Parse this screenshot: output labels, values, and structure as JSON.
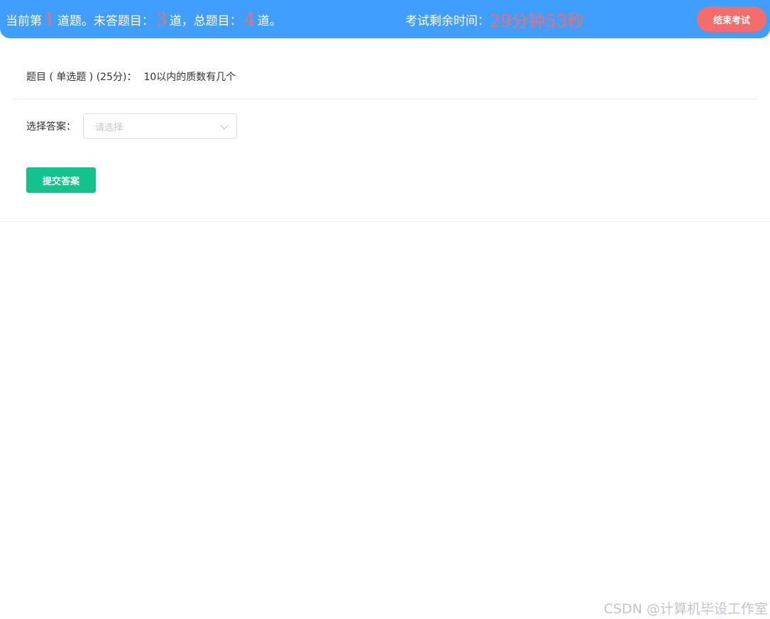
{
  "header": {
    "progress_prefix": "当前第",
    "current_index": "1",
    "progress_mid1": "道题。未答题目：",
    "unanswered": "3",
    "progress_mid2": "道，总题目：",
    "total": "4",
    "progress_suffix": "道。",
    "timer_label": "考试剩余时间：",
    "timer_value": "29分钟53秒",
    "end_button": "结束考试"
  },
  "question": {
    "meta": "题目 ( 单选题 ) (25分)：",
    "text": "10以内的质数有几个"
  },
  "answer": {
    "label": "选择答案：",
    "placeholder": "请选择",
    "dropdown_icon": "chevron-down-icon"
  },
  "submit_button": "提交答案",
  "watermark": "CSDN @计算机毕设工作室",
  "colors": {
    "header_bg": "#409eff",
    "accent_red": "#f56c6c",
    "submit_green": "#13c28d"
  }
}
